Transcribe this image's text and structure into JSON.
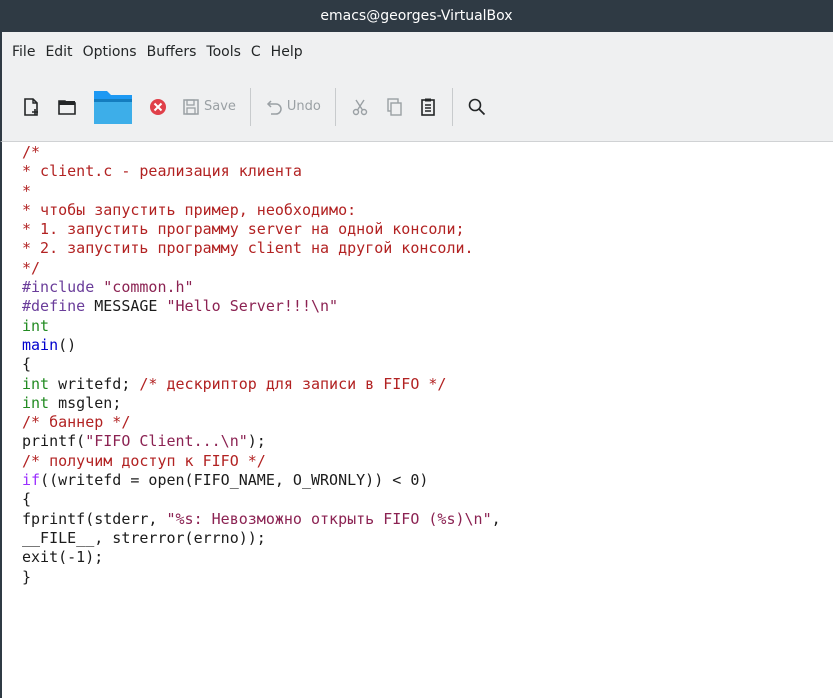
{
  "window": {
    "title": "emacs@georges-VirtualBox"
  },
  "menu": {
    "items": [
      "File",
      "Edit",
      "Options",
      "Buffers",
      "Tools",
      "C",
      "Help"
    ]
  },
  "toolbar": {
    "save_label": "Save",
    "undo_label": "Undo"
  },
  "icons": {
    "new_file": "new-file-icon",
    "open_dir": "open-directory-icon",
    "folder": "folder-icon",
    "close": "close-buffer-icon",
    "save": "save-icon",
    "undo": "undo-icon",
    "cut": "cut-icon",
    "copy": "copy-icon",
    "paste": "paste-icon",
    "search": "search-icon"
  },
  "colors": {
    "comment": "#b22222",
    "preprocessor": "#6a3d9a",
    "string": "#8b2252",
    "type": "#228b22",
    "function": "#0000cd",
    "keyword": "#9b30ff",
    "text": "#1b1b1b",
    "close_red": "#e0404a",
    "folder_blue": "#1d99f3",
    "titlebar": "#2f3a44"
  },
  "code": {
    "lines": [
      [
        [
          "comment",
          "/*"
        ]
      ],
      [
        [
          "comment",
          "* client.c - реализация клиента"
        ]
      ],
      [
        [
          "comment",
          "*"
        ]
      ],
      [
        [
          "comment",
          "* чтобы запустить пример, необходимо:"
        ]
      ],
      [
        [
          "comment",
          "* 1. запустить программу server на одной консоли;"
        ]
      ],
      [
        [
          "comment",
          "* 2. запустить программу client на другой консоли."
        ]
      ],
      [
        [
          "comment",
          "*/"
        ]
      ],
      [
        [
          "prep",
          "#include "
        ],
        [
          "str",
          "\"common.h\""
        ]
      ],
      [
        [
          "prep",
          "#define "
        ],
        [
          "plain",
          "MESSAGE "
        ],
        [
          "str",
          "\"Hello Server!!!\\n\""
        ]
      ],
      [
        [
          "type",
          "int"
        ]
      ],
      [
        [
          "fn",
          "main"
        ],
        [
          "plain",
          "()"
        ]
      ],
      [
        [
          "plain",
          "{"
        ]
      ],
      [
        [
          "type",
          "int "
        ],
        [
          "plain",
          "writefd"
        ],
        [
          "plain",
          "; "
        ],
        [
          "comment",
          "/* дескриптор для записи в FIFO */"
        ]
      ],
      [
        [
          "type",
          "int "
        ],
        [
          "plain",
          "msglen"
        ],
        [
          "plain",
          ";"
        ]
      ],
      [
        [
          "comment",
          "/* баннер */"
        ]
      ],
      [
        [
          "plain",
          "printf("
        ],
        [
          "str",
          "\"FIFO Client...\\n\""
        ],
        [
          "plain",
          ");"
        ]
      ],
      [
        [
          "comment",
          "/* получим доступ к FIFO */"
        ]
      ],
      [
        [
          "kw",
          "if"
        ],
        [
          "plain",
          "((writefd = open(FIFO_NAME, O_WRONLY)) < 0)"
        ]
      ],
      [
        [
          "plain",
          "{"
        ]
      ],
      [
        [
          "plain",
          "fprintf(stderr, "
        ],
        [
          "str",
          "\"%s: Невозможно открыть FIFO (%s)\\n\""
        ],
        [
          "plain",
          ","
        ]
      ],
      [
        [
          "plain",
          "__FILE__, strerror(errno));"
        ]
      ],
      [
        [
          "plain",
          "exit(-1);"
        ]
      ],
      [
        [
          "plain",
          "}"
        ]
      ]
    ]
  }
}
